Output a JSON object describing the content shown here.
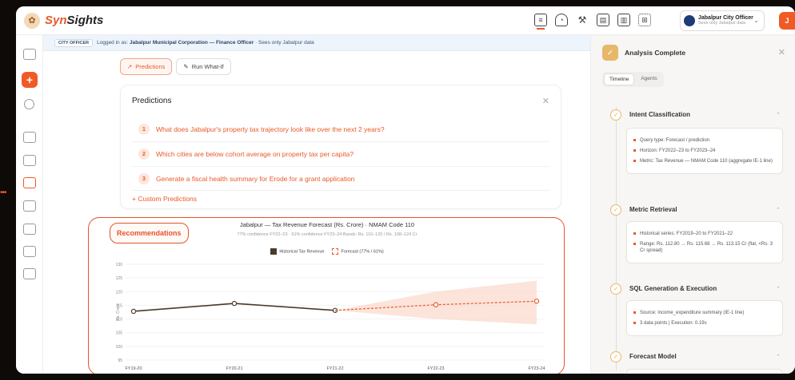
{
  "brand": {
    "name_a": "Syn",
    "name_b": "Sights"
  },
  "user": {
    "name": "Jabalpur City Officer",
    "sub": "Sees only Jabalpur data",
    "initial": "J"
  },
  "banner": {
    "badge": "CITY OFFICER",
    "prefix": "Logged in as:",
    "org": "Jabalpur Municipal Corporation — Finance Officer",
    "suffix": " · Sees only Jabalpur data"
  },
  "pills": {
    "predictions": "Predictions",
    "whatif": "Run What-If"
  },
  "predictions": {
    "title": "Predictions",
    "items": [
      {
        "num": "1",
        "text": "What does Jabalpur's property tax trajectory look like over the next 2 years?"
      },
      {
        "num": "2",
        "text": "Which cities are below cohort average on property tax per capita?"
      },
      {
        "num": "3",
        "text": "Generate a fiscal health summary for Erode for a grant application"
      }
    ],
    "custom": "+ Custom Predictions"
  },
  "recommendations_label": "Recommendations",
  "chart_data": {
    "type": "line",
    "title": "Jabalpur — Tax Revenue Forecast (Rs. Crore) · NMAM Code 110",
    "subtitle": "77% confidence FY22–23 · 61% confidence FY23–24   Bands: Rs. 110–120 / Rs. 108–124 Cr",
    "ylabel": "Rs. Crore",
    "categories": [
      "FY19-20",
      "FY20-21",
      "FY21-22",
      "FY22-23",
      "FY23-24"
    ],
    "yticks": [
      95,
      100,
      105,
      110,
      115,
      120,
      125,
      130
    ],
    "ylim": [
      95,
      130
    ],
    "series": [
      {
        "name": "Historical Tax Revenue",
        "values": [
          112.8,
          115.68,
          113.15,
          null,
          null
        ],
        "color": "#4b3a2a"
      },
      {
        "name": "Forecast (77% / 61%)",
        "values": [
          null,
          null,
          113.15,
          115.2,
          116.5
        ],
        "color": "#e85a2a"
      }
    ],
    "bands": {
      "FY22-23": [
        110,
        120
      ],
      "FY23-24": [
        108,
        124
      ]
    }
  },
  "panel": {
    "title": "Analysis Complete",
    "tabs": [
      "Timeline",
      "Agents"
    ],
    "sections": [
      {
        "title": "Intent Classification",
        "bullets": [
          "Query type: Forecast / prediction",
          "Horizon: FY2022–23 to FY2023–24",
          "Metric: Tax Revenue — NMAM Code 110 (aggregate IE-1 line)"
        ]
      },
      {
        "title": "Metric Retrieval",
        "bullets": [
          "Historical series: FY2019–20 to FY2021–22",
          "Range: Rs. 112.80 → Rs. 115.68 → Rs. 113.15 Cr (flat, <Rs. 3 Cr spread)"
        ]
      },
      {
        "title": "SQL Generation & Execution",
        "bullets": [
          "Source: income_expenditure summary (IE-1 line)",
          "3 data points | Execution: 0.19s"
        ]
      },
      {
        "title": "Forecast Model",
        "bullets": []
      }
    ]
  }
}
